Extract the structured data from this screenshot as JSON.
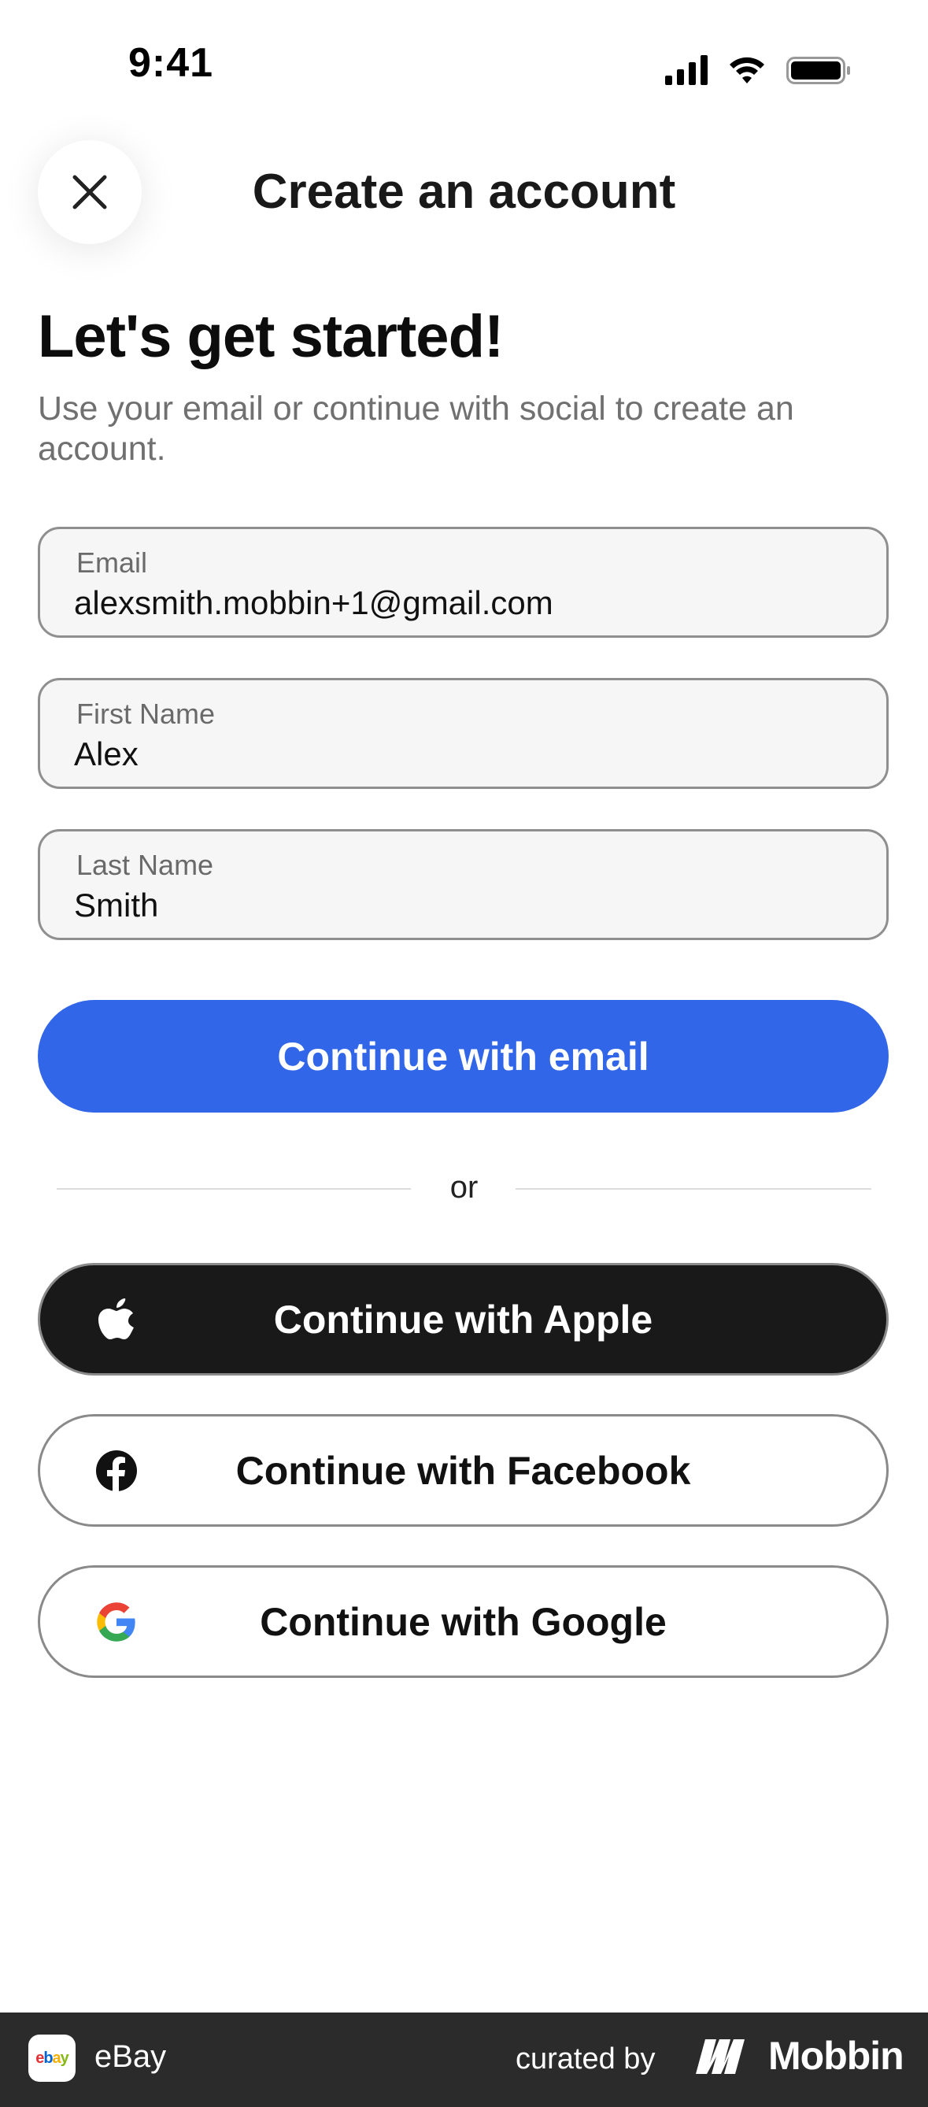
{
  "status_bar": {
    "time": "9:41"
  },
  "header": {
    "title": "Create an account"
  },
  "hero": {
    "title": "Let's get started!",
    "subtitle": "Use your email or continue with social to create an account."
  },
  "form": {
    "email": {
      "label": "Email",
      "value": "alexsmith.mobbin+1@gmail.com"
    },
    "first_name": {
      "label": "First Name",
      "value": "Alex"
    },
    "last_name": {
      "label": "Last Name",
      "value": "Smith"
    },
    "submit_label": "Continue with email"
  },
  "divider": {
    "text": "or"
  },
  "social": {
    "apple_label": "Continue with Apple",
    "facebook_label": "Continue with Facebook",
    "google_label": "Continue with Google"
  },
  "footer": {
    "app_icon_text": {
      "e": "e",
      "b": "b",
      "a": "a",
      "y": "y"
    },
    "app_name": "eBay",
    "curated_by": "curated by",
    "brand": "Mobbin"
  },
  "colors": {
    "primary_blue": "#3166e8",
    "apple_black": "#191919",
    "facebook_blue": "#1877f2",
    "footer_bg": "#2b2b2b"
  },
  "icons": [
    "signal-icon",
    "wifi-icon",
    "battery-icon",
    "close-icon",
    "apple-icon",
    "facebook-icon",
    "google-icon",
    "ebay-app-icon",
    "mobbin-logo-icon"
  ]
}
